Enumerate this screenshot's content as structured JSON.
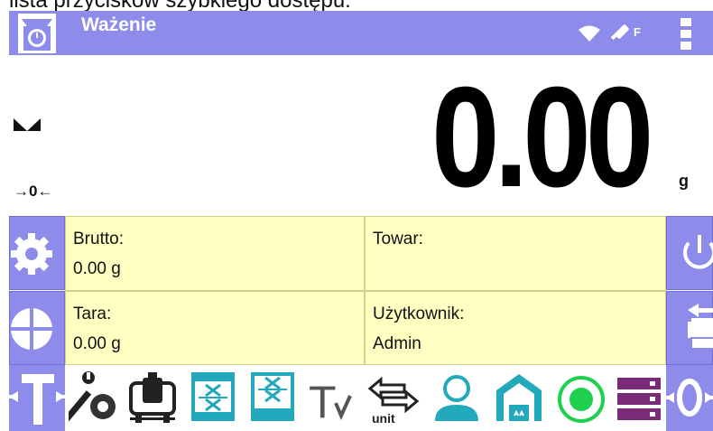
{
  "caption": "lista przycisków szybkiego dostępu:",
  "titlebar": {
    "title": "Ważenie",
    "status_letter": "F",
    "icons": [
      "scale-logo-icon",
      "wifi-icon",
      "key-icon",
      "menu-dots-icon"
    ]
  },
  "reading": {
    "value": "0.00",
    "unit": "g",
    "zero_indicator": "→0←",
    "stability_icon": "stable-marker-icon"
  },
  "info": {
    "gross_label": "Brutto:",
    "gross_value": "0.00 g",
    "product_label": "Towar:",
    "product_value": "",
    "tare_label": "Tara:",
    "tare_value": "0.00 g",
    "user_label": "Użytkownik:",
    "user_value": "Admin"
  },
  "side_buttons": {
    "left": [
      "settings-gear-icon",
      "target-icon",
      "tare-icon"
    ],
    "right": [
      "power-icon",
      "printer-icon",
      "zero-icon"
    ]
  },
  "quick_buttons": {
    "icons": [
      "service-tools-icon",
      "calibration-weight-icon",
      "tare-select-icon",
      "tare-database-icon",
      "tare-value-icon",
      "unit-change-icon",
      "user-icon",
      "product-icon",
      "status-green-icon",
      "database-icon"
    ],
    "tare_letter": "T",
    "unit_label": "unit"
  },
  "colors": {
    "accent": "#8e8cea",
    "info_bg": "#ffffc2",
    "teal": "#22a9bb",
    "green": "#1fd04f",
    "purple": "#7a2b78"
  }
}
